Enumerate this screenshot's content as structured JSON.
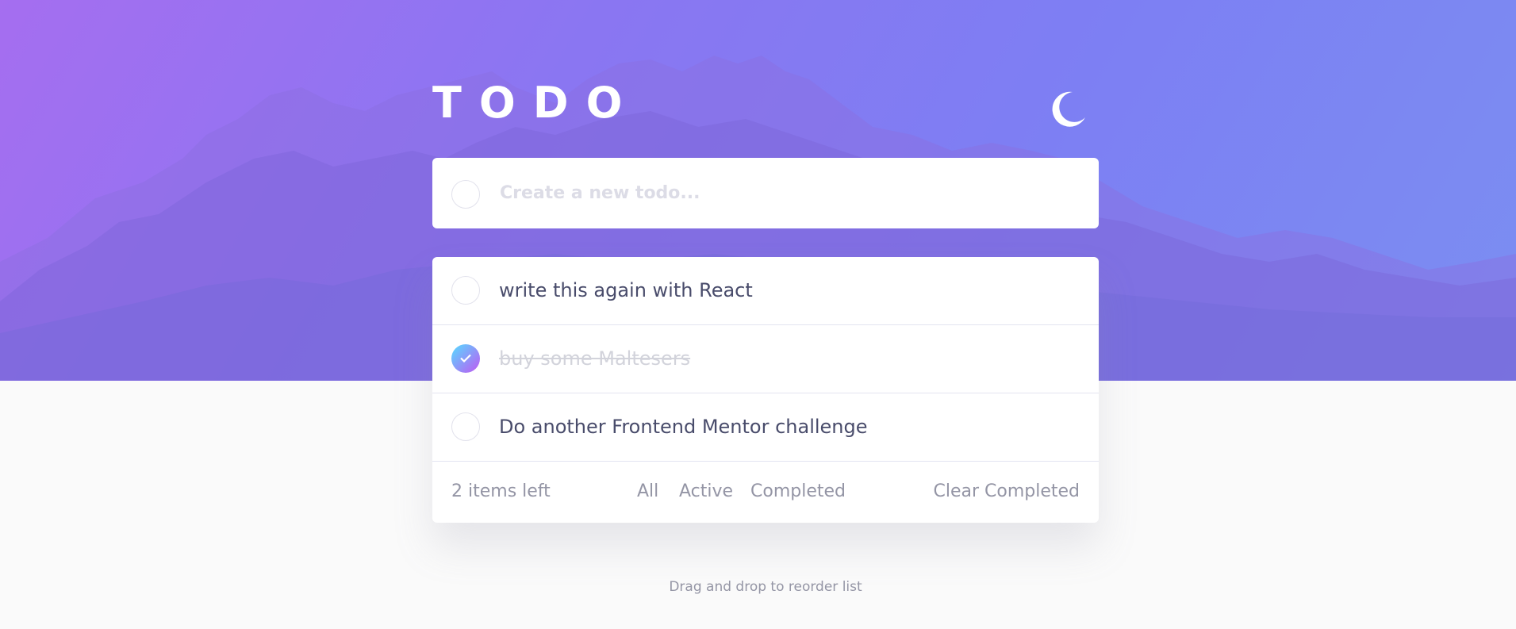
{
  "app": {
    "title": "TODO",
    "theme_icon": "moon-icon"
  },
  "new_todo": {
    "placeholder": "Create a new todo...",
    "value": ""
  },
  "todos": [
    {
      "text": "write this again with React",
      "completed": false
    },
    {
      "text": "buy some Maltesers",
      "completed": true
    },
    {
      "text": "Do another Frontend Mentor challenge",
      "completed": false
    }
  ],
  "footer": {
    "items_left": "2 items left",
    "filters": [
      "All",
      "Active",
      "Completed"
    ],
    "clear": "Clear Completed"
  },
  "hint": "Drag and drop to reorder list",
  "colors": {
    "accent_start": "#55ddff",
    "accent_end": "#c058f3",
    "text_dark": "#494c6b",
    "text_muted": "#9495a5",
    "completed_text": "#d2d3db"
  }
}
